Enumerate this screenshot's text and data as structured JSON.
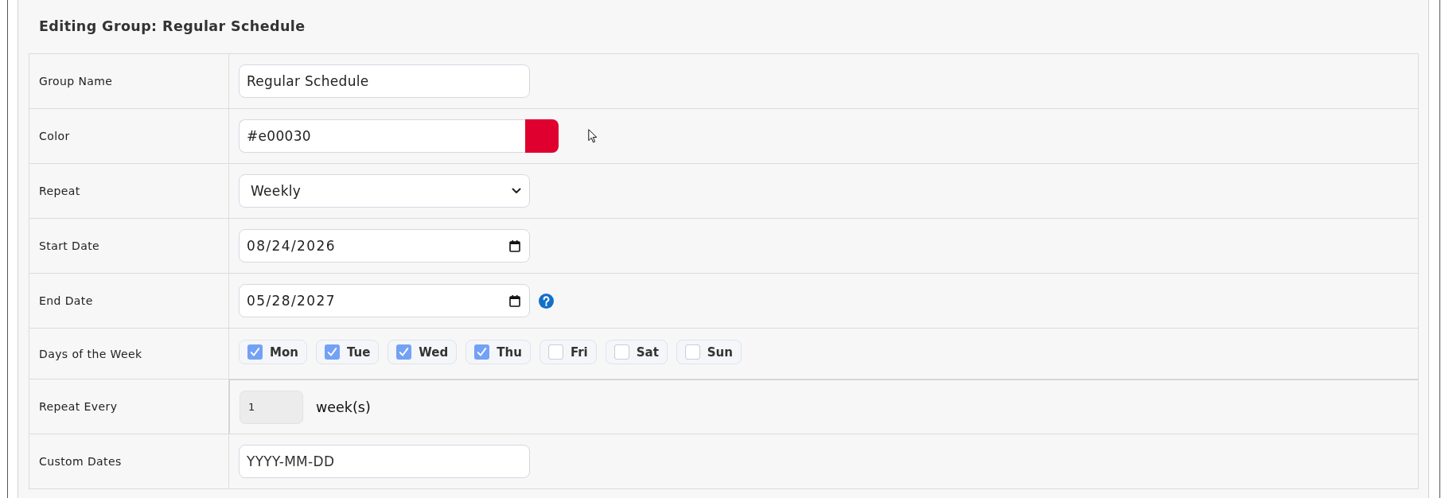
{
  "title": "Editing Group: Regular Schedule",
  "fields": [
    {
      "kind": "text",
      "label": "Group Name",
      "value": "Regular Schedule"
    },
    {
      "kind": "color",
      "label": "Color",
      "value": "#e00030",
      "color": "#e00030"
    },
    {
      "kind": "select",
      "label": "Repeat",
      "value": "Weekly"
    },
    {
      "kind": "date",
      "label": "Start Date",
      "value": "08/24/2026"
    },
    {
      "kind": "date",
      "label": "End Date",
      "value": "05/28/2027",
      "help": true
    },
    {
      "kind": "days",
      "label": "Days of the Week",
      "days": [
        {
          "label": "Mon",
          "checked": true
        },
        {
          "label": "Tue",
          "checked": true
        },
        {
          "label": "Wed",
          "checked": true
        },
        {
          "label": "Thu",
          "checked": true
        },
        {
          "label": "Fri",
          "checked": false
        },
        {
          "label": "Sat",
          "checked": false
        },
        {
          "label": "Sun",
          "checked": false
        }
      ]
    },
    {
      "kind": "number",
      "label": "Repeat Every",
      "value": "1",
      "unit": "week(s)"
    },
    {
      "kind": "text",
      "label": "Custom Dates",
      "placeholder": "YYYY-MM-DD"
    }
  ]
}
